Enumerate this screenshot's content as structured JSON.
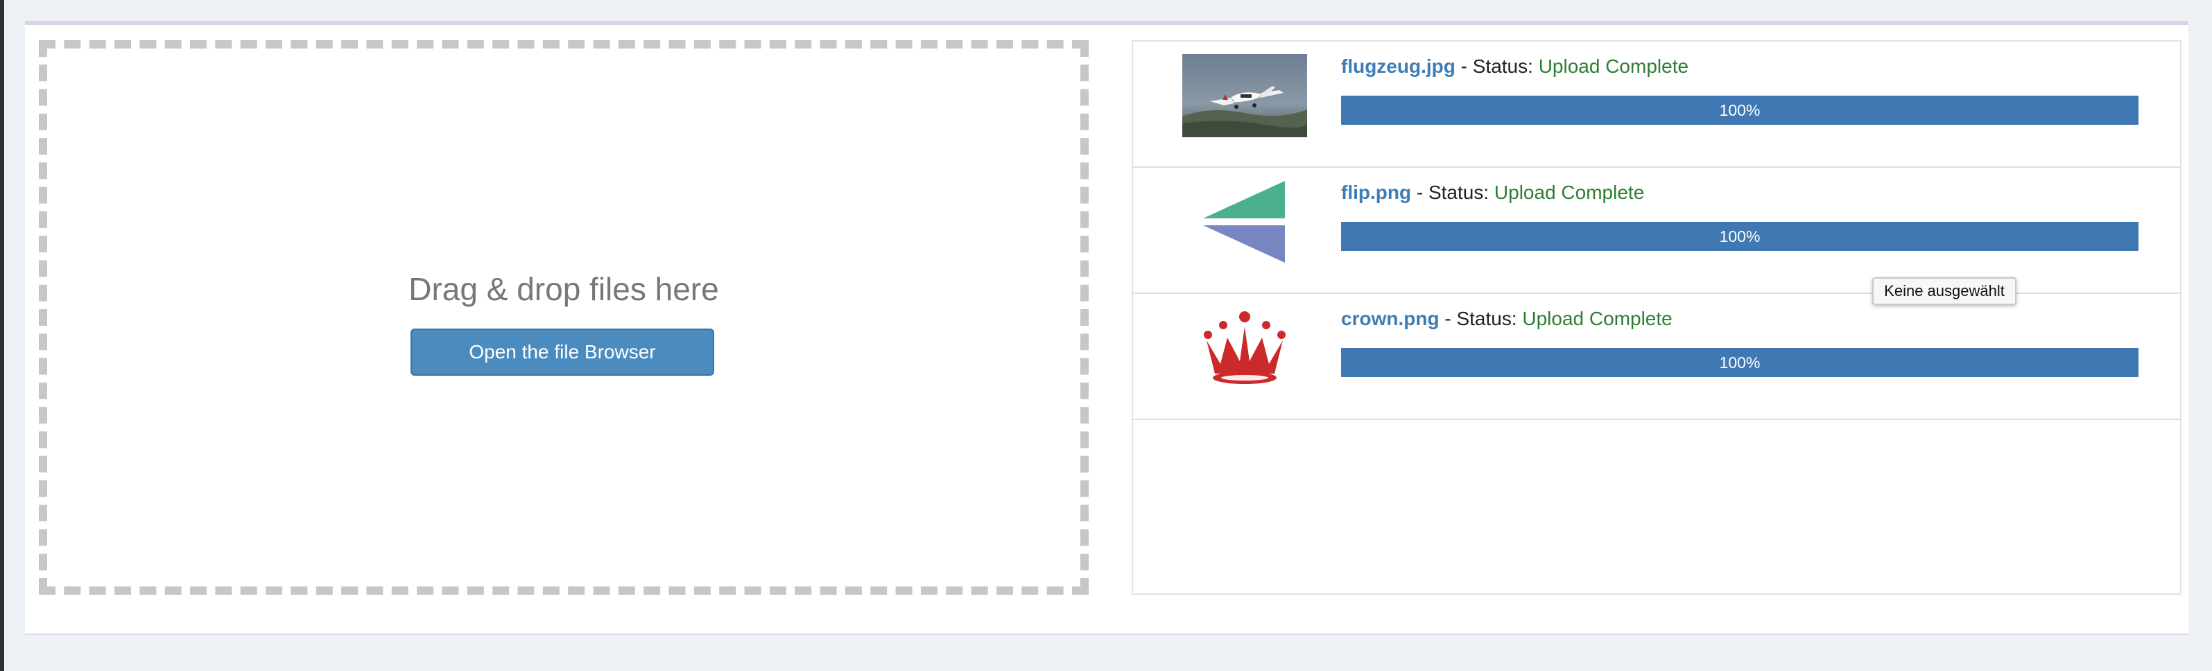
{
  "dropzone": {
    "text": "Drag & drop files here",
    "button_label": "Open the file Browser"
  },
  "status_label": "Status:",
  "separator": "-",
  "files": [
    {
      "name": "flugzeug.jpg",
      "status": "Upload Complete",
      "progress_percent": 100,
      "progress_label": "100%",
      "thumbnail_icon": "airplane-photo"
    },
    {
      "name": "flip.png",
      "status": "Upload Complete",
      "progress_percent": 100,
      "progress_label": "100%",
      "thumbnail_icon": "flip-logo"
    },
    {
      "name": "crown.png",
      "status": "Upload Complete",
      "progress_percent": 100,
      "progress_label": "100%",
      "thumbnail_icon": "crown"
    }
  ],
  "tooltip": {
    "text": "Keine ausgewählt"
  },
  "colors": {
    "progress": "#3f78b3",
    "button": "#4b8bbe",
    "link": "#3d7cb5",
    "status_ok": "#2e7d32"
  }
}
